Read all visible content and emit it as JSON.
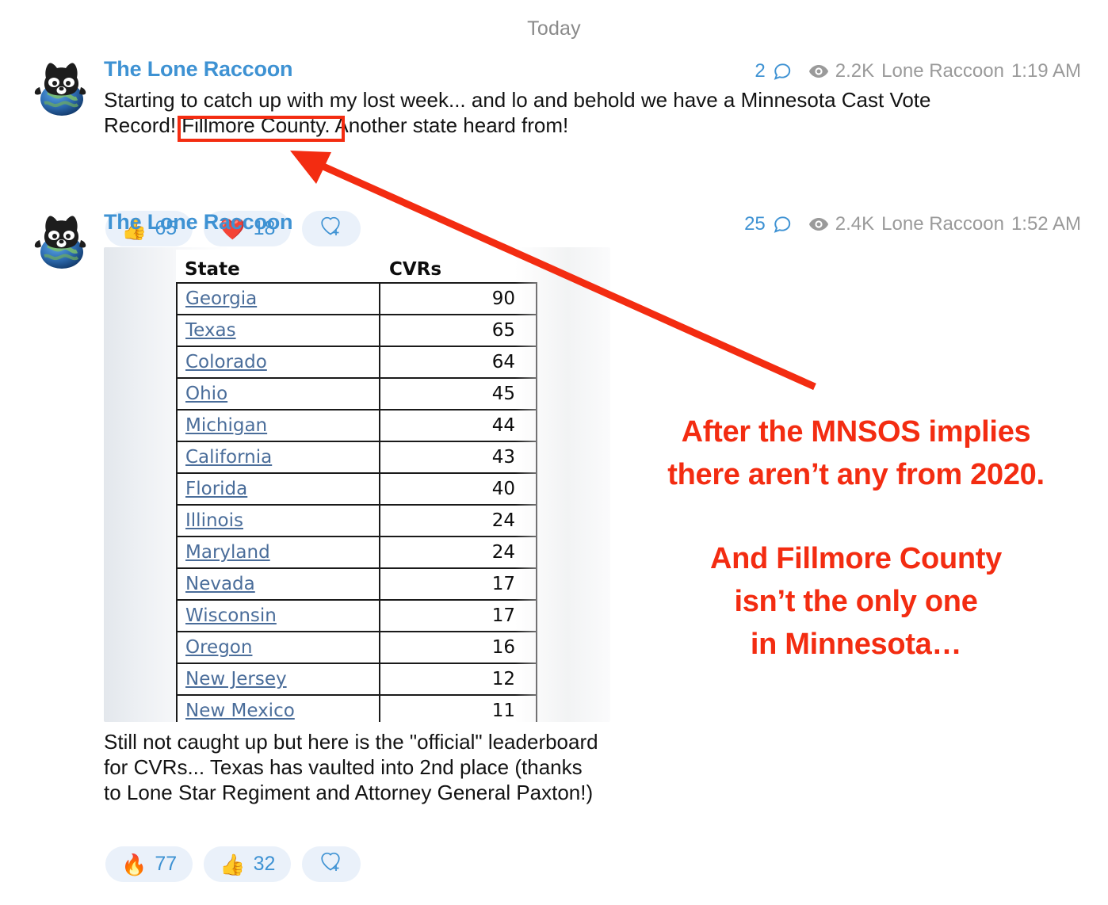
{
  "day_divider": "Today",
  "messages": [
    {
      "author": "The Lone Raccoon",
      "avatar_icon": "raccoon-globe-avatar",
      "reply_count": "2",
      "view_count": "2.2K",
      "signature": "Lone Raccoon",
      "time": "1:19 AM",
      "text_line1": "Starting to catch up with my lost week... and lo and behold we have a Minnesota Cast Vote",
      "text_line2_pre": "Record! ",
      "text_line2_highlight": "Fillmore County.",
      "text_line2_post": " Another state heard from!",
      "reactions": [
        {
          "emoji": "👍",
          "icon": "thumbs-up-emoji",
          "count": "65"
        },
        {
          "emoji": "❤️",
          "icon": "red-heart-emoji",
          "count": "18"
        },
        {
          "emoji": "",
          "icon": "add-reaction-icon",
          "count": ""
        }
      ]
    },
    {
      "author": "The Lone Raccoon",
      "avatar_icon": "raccoon-globe-avatar",
      "reply_count": "25",
      "view_count": "2.4K",
      "signature": "Lone Raccoon",
      "time": "1:52 AM",
      "caption": "Still not caught up but here is the \"official\" leaderboard for CVRs... Texas has vaulted into 2nd place (thanks to Lone Star Regiment and Attorney General Paxton!)",
      "reactions": [
        {
          "emoji": "🔥",
          "icon": "fire-emoji",
          "count": "77"
        },
        {
          "emoji": "👍",
          "icon": "thumbs-up-emoji",
          "count": "32"
        },
        {
          "emoji": "",
          "icon": "add-reaction-icon",
          "count": ""
        }
      ]
    }
  ],
  "chart_data": {
    "type": "table",
    "title": "",
    "columns": [
      "State",
      "CVRs"
    ],
    "categories": [
      "Georgia",
      "Texas",
      "Colorado",
      "Ohio",
      "Michigan",
      "California",
      "Florida",
      "Illinois",
      "Maryland",
      "Nevada",
      "Wisconsin",
      "Oregon",
      "New Jersey",
      "New Mexico"
    ],
    "values": [
      90,
      65,
      64,
      45,
      44,
      43,
      40,
      24,
      24,
      17,
      17,
      16,
      12,
      11
    ],
    "rows": [
      {
        "state": "Georgia",
        "cvrs": "90"
      },
      {
        "state": "Texas",
        "cvrs": "65"
      },
      {
        "state": "Colorado",
        "cvrs": "64"
      },
      {
        "state": "Ohio",
        "cvrs": "45"
      },
      {
        "state": "Michigan",
        "cvrs": "44"
      },
      {
        "state": "California",
        "cvrs": "43"
      },
      {
        "state": "Florida",
        "cvrs": "40"
      },
      {
        "state": "Illinois",
        "cvrs": "24"
      },
      {
        "state": "Maryland",
        "cvrs": "24"
      },
      {
        "state": "Nevada",
        "cvrs": "17"
      },
      {
        "state": "Wisconsin",
        "cvrs": "17"
      },
      {
        "state": "Oregon",
        "cvrs": "16"
      },
      {
        "state": "New Jersey",
        "cvrs": "12"
      },
      {
        "state": "New Mexico",
        "cvrs": "11"
      }
    ],
    "xlabel": "State",
    "ylabel": "CVRs",
    "ylim": [
      0,
      90
    ]
  },
  "annotation": {
    "line1": "After the MNSOS implies",
    "line2": "there aren’t any from 2020.",
    "line3": "And Fillmore County",
    "line4": "isn’t the only one",
    "line5": "in Minnesota…",
    "color": "#f32c11",
    "arrow_icon": "red-arrow-annotation",
    "box_icon": "red-highlight-box"
  },
  "colors": {
    "accent_blue": "#3e92d3",
    "annotation_red": "#f32c11",
    "pill_background": "#eaf1fa",
    "meta_grey": "#9a9a9a",
    "link_blue": "#4a6d9a"
  }
}
